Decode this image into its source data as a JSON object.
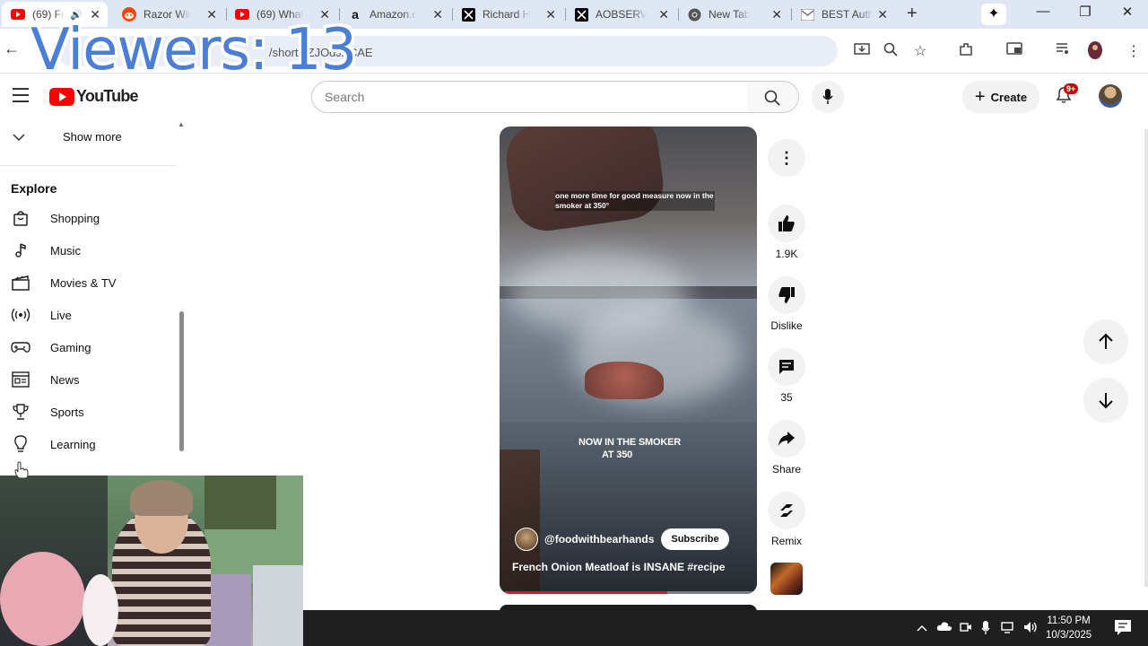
{
  "overlay": {
    "viewers_text": "Viewers: 13"
  },
  "browser": {
    "tabs": [
      {
        "title": "(69) Fr",
        "favicon": "youtube-icon",
        "active": true,
        "muted_icon": "speaker-icon"
      },
      {
        "title": "Razor Wir",
        "favicon": "reddit-icon"
      },
      {
        "title": "(69) What",
        "favicon": "youtube-icon"
      },
      {
        "title": "Amazon.c",
        "favicon": "amazon-icon"
      },
      {
        "title": "Richard H",
        "favicon": "x-icon"
      },
      {
        "title": "AOBSERV",
        "favicon": "x-icon"
      },
      {
        "title": "New Tab",
        "favicon": "chrome-icon"
      },
      {
        "title": "BEST Auth",
        "favicon": "gmail-icon"
      }
    ],
    "new_tab_label": "+",
    "url_fragment": "/shorts/ZJOdJZCAE",
    "window_controls": {
      "minimize": "—",
      "restore": "❐",
      "close": "✕"
    }
  },
  "youtube": {
    "logo_text": "YouTube",
    "search_placeholder": "Search",
    "create_label": "Create",
    "notification_badge": "9+",
    "sidebar": {
      "show_more": "Show more",
      "explore_heading": "Explore",
      "items": [
        {
          "label": "Shopping",
          "icon": "shopping-bag-icon"
        },
        {
          "label": "Music",
          "icon": "music-note-icon"
        },
        {
          "label": "Movies & TV",
          "icon": "clapperboard-icon"
        },
        {
          "label": "Live",
          "icon": "live-icon"
        },
        {
          "label": "Gaming",
          "icon": "gamepad-icon"
        },
        {
          "label": "News",
          "icon": "newspaper-icon"
        },
        {
          "label": "Sports",
          "icon": "trophy-icon"
        },
        {
          "label": "Learning",
          "icon": "lightbulb-icon"
        }
      ]
    },
    "short": {
      "caption_top": "one more time for good measure now in the smoker at 350°",
      "caption_mid_line1": "NOW IN THE SMOKER",
      "caption_mid_line2": "AT 350",
      "channel": "@foodwithbearhands",
      "subscribe_label": "Subscribe",
      "title": "French Onion Meatloaf is INSANE #recipe",
      "progress_fraction": 0.65
    },
    "actions": {
      "like_count": "1.9K",
      "dislike_label": "Dislike",
      "comment_count": "35",
      "share_label": "Share",
      "remix_label": "Remix"
    }
  },
  "taskbar": {
    "time": "11:50 PM",
    "date": "10/3/2025"
  }
}
